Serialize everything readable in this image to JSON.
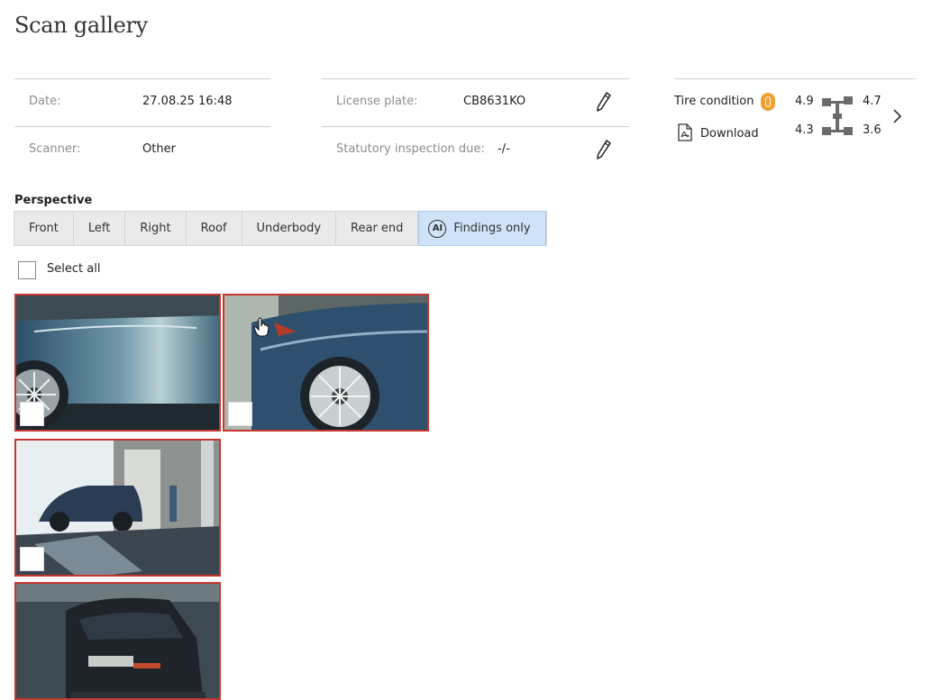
{
  "page": {
    "title": "Scan gallery"
  },
  "info": {
    "date_label": "Date:",
    "date_value": "27.08.25 16:48",
    "scanner_label": "Scanner:",
    "scanner_value": "Other",
    "license_label": "License plate:",
    "license_value": "CB8631KO",
    "inspection_label": "Statutory inspection due:",
    "inspection_value": "-/-"
  },
  "tire": {
    "label": "Tire condition",
    "front_left": "4.9",
    "front_right": "4.7",
    "rear_left": "4.3",
    "rear_right": "3.6",
    "download_label": "Download",
    "badge_color": "#f0a030"
  },
  "perspective": {
    "label": "Perspective",
    "tabs": [
      "Front",
      "Left",
      "Right",
      "Roof",
      "Underbody",
      "Rear end"
    ],
    "findings_label": "Findings only",
    "findings_badge": "AI",
    "active_tab": "Findings only"
  },
  "gallery": {
    "select_all_label": "Select all",
    "thumbnails": [
      "side-door-view",
      "rear-wheel-view",
      "scanner-bay-view",
      "rear-end-view"
    ],
    "border_color": "#c8372d"
  },
  "icons": {
    "edit": "pencil-icon",
    "download": "pdf-icon",
    "next": "chevron-right-icon",
    "axle": "axle-diagram-icon",
    "tire": "tire-icon",
    "cursor": "hand-cursor-icon"
  }
}
